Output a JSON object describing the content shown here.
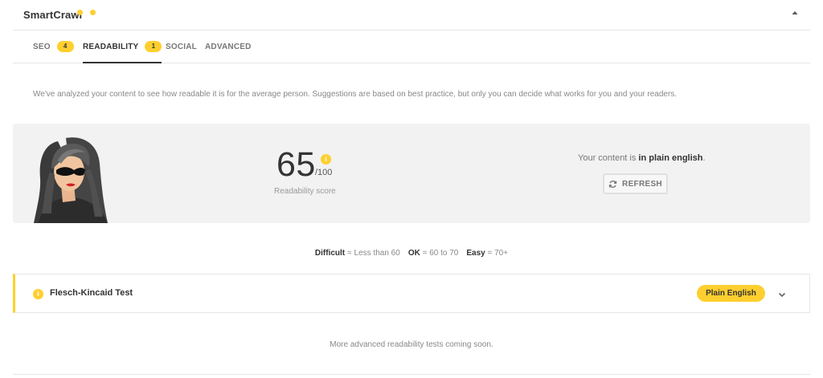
{
  "header": {
    "title": "SmartCrawl",
    "collapse_icon": "caret-up-icon"
  },
  "tabs": [
    {
      "label": "SEO",
      "badge": "4",
      "active": false
    },
    {
      "label": "READABILITY",
      "badge": "1",
      "active": true
    },
    {
      "label": "SOCIAL",
      "active": false
    },
    {
      "label": "ADVANCED",
      "active": false
    }
  ],
  "intro": "We've analyzed your content to see how readable it is for the average person. Suggestions are based on best practice, but only you can decide what works for you and your readers.",
  "score": {
    "value": "65",
    "max": "/100",
    "label": "Readability score",
    "info_icon": "i"
  },
  "status": {
    "prefix": "Your content is ",
    "emphasis": "in plain english",
    "suffix": "."
  },
  "refresh": {
    "label": "REFRESH",
    "icon": "refresh-icon"
  },
  "legend": {
    "difficult_label": "Difficult",
    "difficult_value": " = Less than 60",
    "ok_label": "OK",
    "ok_value": " = 60 to 70",
    "easy_label": "Easy",
    "easy_value": " = 70+"
  },
  "test": {
    "name": "Flesch-Kincaid Test",
    "result": "Plain English",
    "icon": "i"
  },
  "footer": {
    "message": "More advanced readability tests coming soon."
  },
  "colors": {
    "accent": "#fecf2f",
    "panel_bg": "#f2f2f2",
    "border": "#e6e6e6"
  }
}
